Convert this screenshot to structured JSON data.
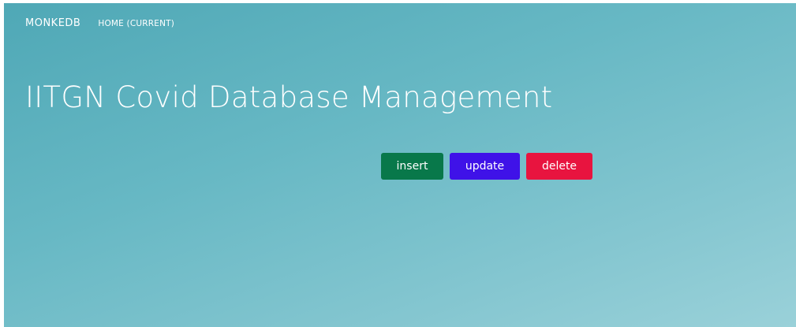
{
  "navbar": {
    "brand": "MONKEDB",
    "links": [
      {
        "label": "HOME (CURRENT)"
      }
    ]
  },
  "main": {
    "title": "IITGN Covid Database Management",
    "buttons": {
      "insert": "insert",
      "update": "update",
      "delete": "delete"
    }
  },
  "colors": {
    "background_start": "#4fa8b6",
    "background_end": "#9ad1d9",
    "insert": "#08784a",
    "update": "#3f12e8",
    "delete": "#e8143f"
  }
}
